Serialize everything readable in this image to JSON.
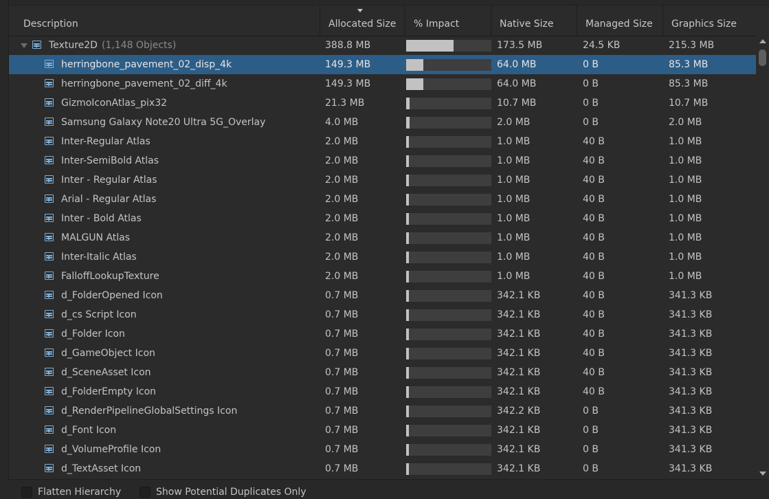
{
  "columns": {
    "description": "Description",
    "allocated": "Allocated Size",
    "impact": "% Impact",
    "native": "Native Size",
    "managed": "Managed Size",
    "graphics": "Graphics Size"
  },
  "group": {
    "name": "Texture2D",
    "count": "(1,148 Objects)",
    "allocated": "388.8 MB",
    "impact": 0.56,
    "native": "173.5 MB",
    "managed": "24.5 KB",
    "graphics": "215.3 MB"
  },
  "rows": [
    {
      "name": "herringbone_pavement_02_disp_4k",
      "allocated": "149.3 MB",
      "impact": 0.2,
      "native": "64.0 MB",
      "managed": "0 B",
      "graphics": "85.3 MB",
      "selected": true
    },
    {
      "name": "herringbone_pavement_02_diff_4k",
      "allocated": "149.3 MB",
      "impact": 0.2,
      "native": "64.0 MB",
      "managed": "0 B",
      "graphics": "85.3 MB"
    },
    {
      "name": "GizmoIconAtlas_pix32",
      "allocated": "21.3 MB",
      "impact": 0.04,
      "native": "10.7 MB",
      "managed": "0 B",
      "graphics": "10.7 MB"
    },
    {
      "name": "Samsung Galaxy Note20 Ultra 5G_Overlay",
      "allocated": "4.0 MB",
      "impact": 0.04,
      "native": "2.0 MB",
      "managed": "0 B",
      "graphics": "2.0 MB"
    },
    {
      "name": "Inter-Regular Atlas",
      "allocated": "2.0 MB",
      "impact": 0.03,
      "native": "1.0 MB",
      "managed": "40 B",
      "graphics": "1.0 MB"
    },
    {
      "name": "Inter-SemiBold Atlas",
      "allocated": "2.0 MB",
      "impact": 0.03,
      "native": "1.0 MB",
      "managed": "40 B",
      "graphics": "1.0 MB"
    },
    {
      "name": "Inter - Regular Atlas",
      "allocated": "2.0 MB",
      "impact": 0.03,
      "native": "1.0 MB",
      "managed": "40 B",
      "graphics": "1.0 MB"
    },
    {
      "name": "Arial - Regular Atlas",
      "allocated": "2.0 MB",
      "impact": 0.03,
      "native": "1.0 MB",
      "managed": "40 B",
      "graphics": "1.0 MB"
    },
    {
      "name": "Inter - Bold Atlas",
      "allocated": "2.0 MB",
      "impact": 0.03,
      "native": "1.0 MB",
      "managed": "40 B",
      "graphics": "1.0 MB"
    },
    {
      "name": "MALGUN Atlas",
      "allocated": "2.0 MB",
      "impact": 0.03,
      "native": "1.0 MB",
      "managed": "40 B",
      "graphics": "1.0 MB"
    },
    {
      "name": "Inter-Italic Atlas",
      "allocated": "2.0 MB",
      "impact": 0.03,
      "native": "1.0 MB",
      "managed": "40 B",
      "graphics": "1.0 MB"
    },
    {
      "name": "FalloffLookupTexture",
      "allocated": "2.0 MB",
      "impact": 0.03,
      "native": "1.0 MB",
      "managed": "40 B",
      "graphics": "1.0 MB"
    },
    {
      "name": "d_FolderOpened Icon",
      "allocated": "0.7 MB",
      "impact": 0.03,
      "native": "342.1 KB",
      "managed": "40 B",
      "graphics": "341.3 KB"
    },
    {
      "name": "d_cs Script Icon",
      "allocated": "0.7 MB",
      "impact": 0.03,
      "native": "342.1 KB",
      "managed": "40 B",
      "graphics": "341.3 KB"
    },
    {
      "name": "d_Folder Icon",
      "allocated": "0.7 MB",
      "impact": 0.03,
      "native": "342.1 KB",
      "managed": "40 B",
      "graphics": "341.3 KB"
    },
    {
      "name": "d_GameObject Icon",
      "allocated": "0.7 MB",
      "impact": 0.03,
      "native": "342.1 KB",
      "managed": "40 B",
      "graphics": "341.3 KB"
    },
    {
      "name": "d_SceneAsset Icon",
      "allocated": "0.7 MB",
      "impact": 0.03,
      "native": "342.1 KB",
      "managed": "40 B",
      "graphics": "341.3 KB"
    },
    {
      "name": "d_FolderEmpty Icon",
      "allocated": "0.7 MB",
      "impact": 0.03,
      "native": "342.1 KB",
      "managed": "40 B",
      "graphics": "341.3 KB"
    },
    {
      "name": "d_RenderPipelineGlobalSettings Icon",
      "allocated": "0.7 MB",
      "impact": 0.03,
      "native": "342.2 KB",
      "managed": "0 B",
      "graphics": "341.3 KB"
    },
    {
      "name": "d_Font Icon",
      "allocated": "0.7 MB",
      "impact": 0.03,
      "native": "342.1 KB",
      "managed": "0 B",
      "graphics": "341.3 KB"
    },
    {
      "name": "d_VolumeProfile Icon",
      "allocated": "0.7 MB",
      "impact": 0.03,
      "native": "342.1 KB",
      "managed": "0 B",
      "graphics": "341.3 KB"
    },
    {
      "name": "d_TextAsset Icon",
      "allocated": "0.7 MB",
      "impact": 0.03,
      "native": "342.1 KB",
      "managed": "0 B",
      "graphics": "341.3 KB"
    }
  ],
  "footer": {
    "flatten": "Flatten Hierarchy",
    "duplicates": "Show Potential Duplicates Only"
  },
  "icons": {
    "row_icon": "texture2d-icon",
    "sort": "sort-descending-icon"
  },
  "colors": {
    "selection": "#2c5d87",
    "icon": "#7fb0d8",
    "bar_fill": "#c2c2c2",
    "bar_track": "#3e3e3e"
  }
}
